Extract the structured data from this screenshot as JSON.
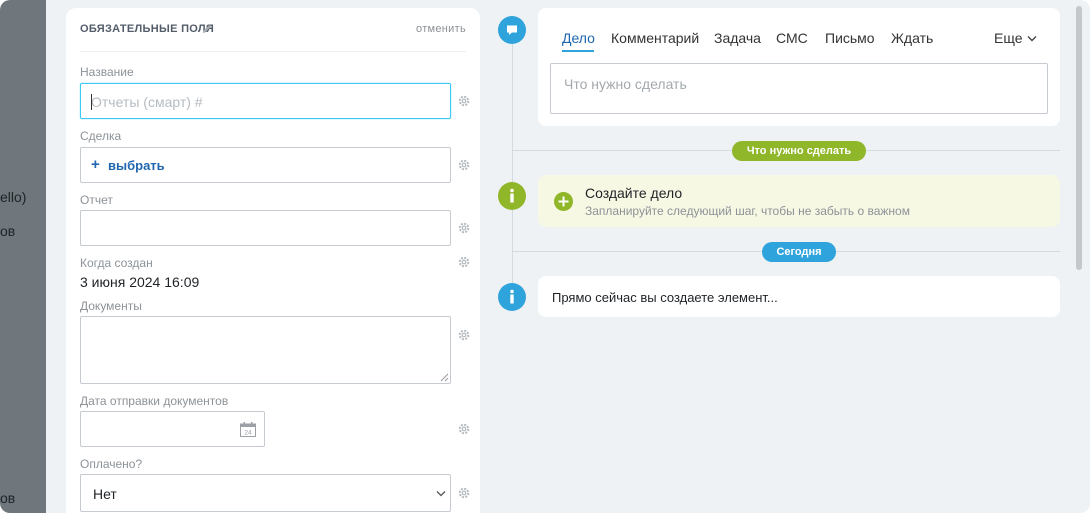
{
  "background": {
    "fragments": [
      "ello)",
      "ов",
      "ов"
    ]
  },
  "form": {
    "title": "ОБЯЗАТЕЛЬНЫЕ ПОЛЯ",
    "cancel_label": "отменить",
    "fields": {
      "name": {
        "label": "Название",
        "placeholder": "Отчеты (смарт) #"
      },
      "deal": {
        "label": "Сделка",
        "action": "выбрать"
      },
      "report": {
        "label": "Отчет",
        "value": ""
      },
      "created": {
        "label": "Когда создан",
        "value": "3 июня 2024 16:09"
      },
      "documents": {
        "label": "Документы",
        "value": ""
      },
      "docs_date": {
        "label": "Дата отправки документов",
        "value": "",
        "calendar_day": "24"
      },
      "paid": {
        "label": "Оплачено?",
        "value": "Нет"
      }
    }
  },
  "timeline": {
    "tabs": [
      {
        "label": "Дело",
        "active": true
      },
      {
        "label": "Комментарий"
      },
      {
        "label": "Задача"
      },
      {
        "label": "СМС"
      },
      {
        "label": "Письмо"
      },
      {
        "label": "Ждать"
      }
    ],
    "more_label": "Еще",
    "todo_placeholder": "Что нужно сделать",
    "todo_pill": "Что нужно сделать",
    "create_title": "Создайте дело",
    "create_subtitle": "Запланируйте следующий шаг, чтобы не забыть о важном",
    "today_pill": "Сегодня",
    "now_text": "Прямо сейчас вы создаете элемент..."
  },
  "colors": {
    "accent_blue": "#2fa4dc",
    "link_blue": "#2067b0",
    "accent_green": "#90b62a",
    "focus_border": "#3bc8f5"
  }
}
